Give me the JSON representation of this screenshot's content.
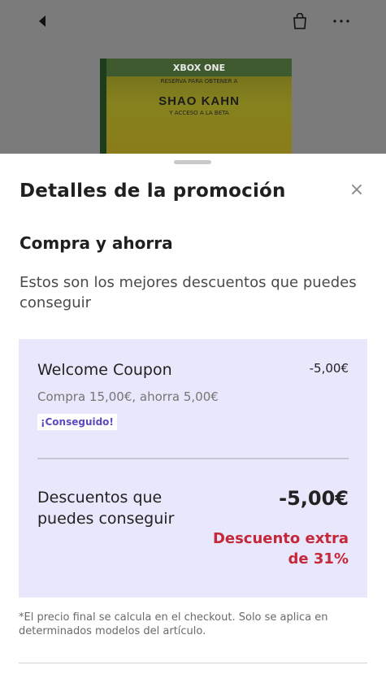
{
  "background": {
    "product_box": {
      "platform": "XBOX ONE",
      "promo_line_1": "RESERVA PARA OBTENER A",
      "promo_highlight": "SHAO KAHN",
      "promo_line_2": "Y ACCESO A LA BETA"
    },
    "icons": {
      "back": "back-arrow-icon",
      "bag": "shopping-bag-icon",
      "more": "more-options-icon"
    }
  },
  "sheet": {
    "title": "Detalles de la promoción",
    "close_icon": "×",
    "section_title": "Compra y ahorra",
    "section_description": "Estos son los mejores descuentos que puedes conseguir",
    "coupon": {
      "name": "Welcome Coupon",
      "amount": "-5,00€",
      "condition": "Compra 15,00€, ahorra 5,00€",
      "badge": "¡Conseguido!"
    },
    "summary": {
      "label": "Descuentos que puedes conseguir",
      "total": "-5,00€",
      "extra": "Descuento extra de 31%"
    },
    "footnote": "*El precio final se calcula en el checkout. Solo se aplica en determinados modelos del artículo."
  },
  "colors": {
    "accent_purple": "#5c4bbf",
    "card_background": "#e9e7fb",
    "extra_discount_red": "#c4283a"
  }
}
